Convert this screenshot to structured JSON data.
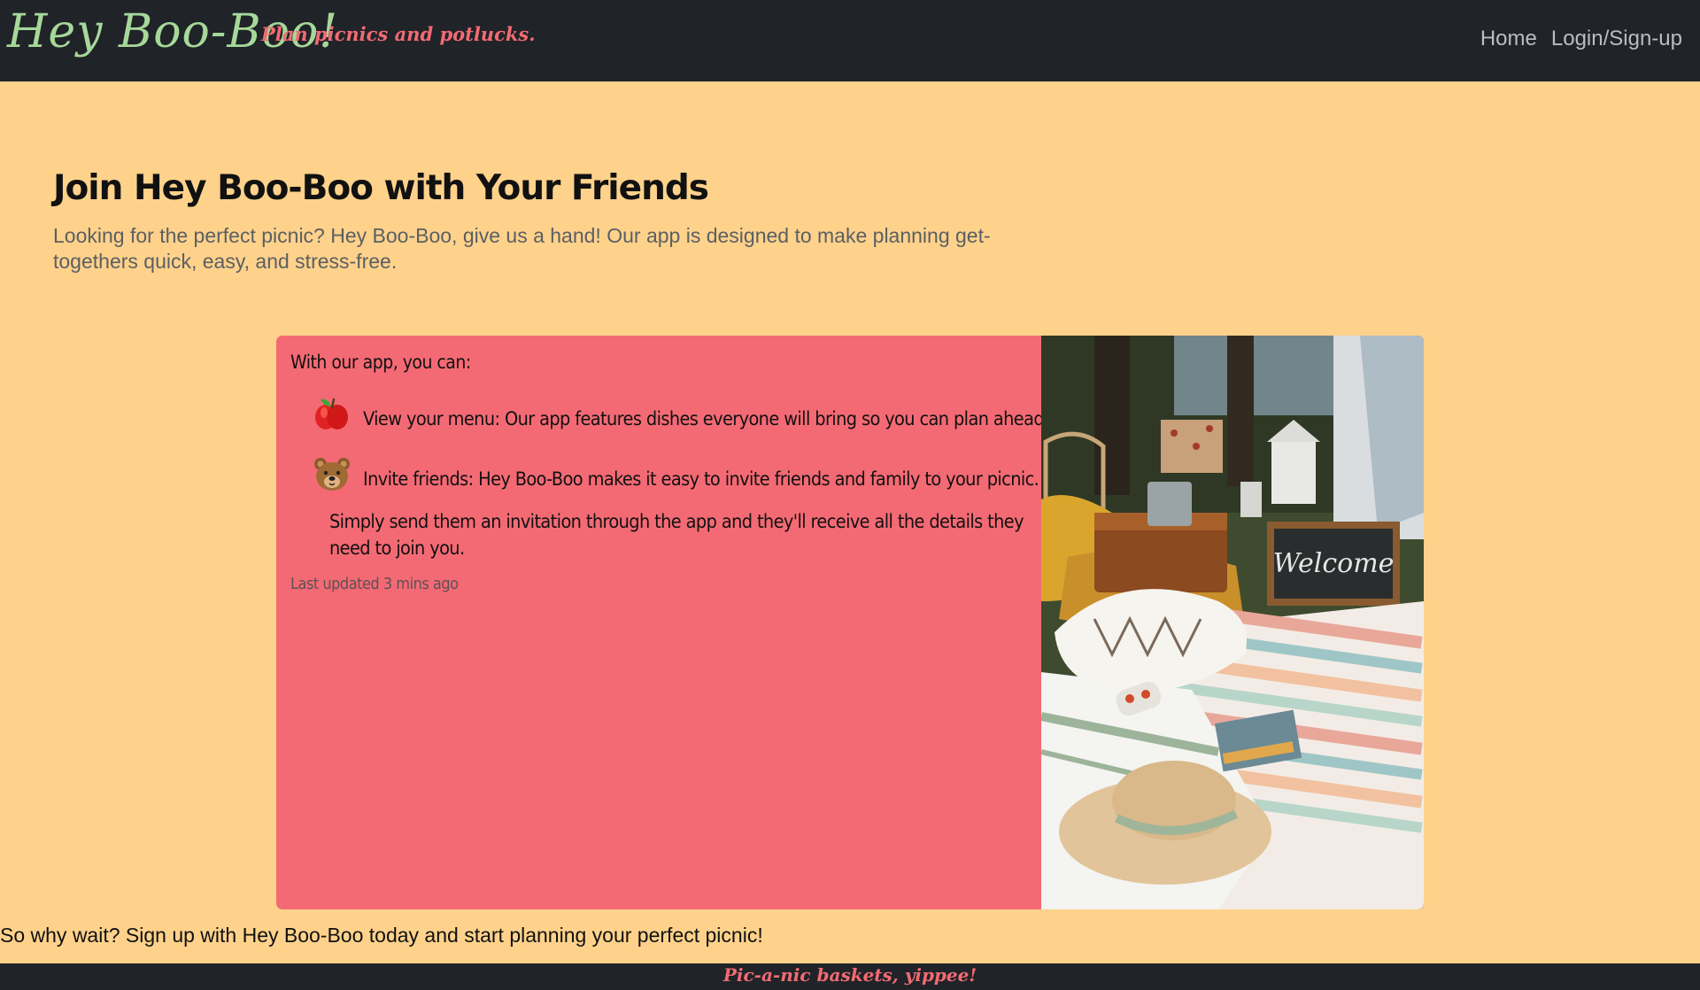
{
  "navbar": {
    "brand": "Hey Boo-Boo!",
    "tagline": "Plan picnics and potlucks.",
    "links": [
      {
        "label": "Home"
      },
      {
        "label": "Login/Sign-up"
      }
    ]
  },
  "hero": {
    "title": "Join Hey Boo-Boo with Your Friends",
    "text": "Looking for the perfect picnic? Hey Boo-Boo, give us a hand! Our app is designed to make planning get-togethers quick, easy, and stress-free."
  },
  "card": {
    "intro": "With our app, you can:",
    "features": [
      {
        "icon": "apple-icon",
        "text": "View your menu: Our app features dishes everyone will bring so you can plan ahead!"
      },
      {
        "icon": "bear-face-icon",
        "text": "Invite friends: Hey Boo-Boo makes it easy to invite friends and family to your picnic.",
        "continuation": "Simply send them an invitation through the app and they'll receive all the details they need to join you."
      }
    ],
    "updated": "Last updated 3 mins ago",
    "image": {
      "sign_text": "Welcome"
    }
  },
  "cta": "So why wait? Sign up with Hey Boo-Boo today and start planning your perfect picnic!",
  "footer": "Pic-a-nic baskets, yippee!",
  "colors": {
    "navbar": "#202328",
    "background": "#ffd28b",
    "card": "#f46a74",
    "brand": "#a6d89a",
    "accent": "#f26b73"
  }
}
